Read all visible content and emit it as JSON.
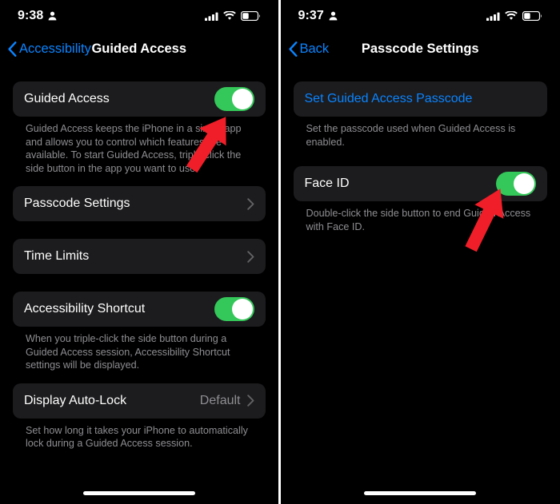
{
  "left": {
    "status": {
      "time": "9:38",
      "person_icon": "person-icon",
      "cellular_icon": "cellular-bars-icon",
      "wifi_icon": "wifi-icon",
      "battery_icon": "battery-icon"
    },
    "nav": {
      "back_label": "Accessibility",
      "title": "Guided Access"
    },
    "guided_access": {
      "label": "Guided Access",
      "toggle_state": "on",
      "footnote": "Guided Access keeps the iPhone in a single app and allows you to control which features are available. To start Guided Access, triple-click the side button in the app you want to use."
    },
    "passcode_settings": {
      "label": "Passcode Settings"
    },
    "time_limits": {
      "label": "Time Limits"
    },
    "accessibility_shortcut": {
      "label": "Accessibility Shortcut",
      "toggle_state": "on",
      "footnote": "When you triple-click the side button during a Guided Access session, Accessibility Shortcut settings will be displayed."
    },
    "display_auto_lock": {
      "label": "Display Auto-Lock",
      "value": "Default",
      "footnote": "Set how long it takes your iPhone to automatically lock during a Guided Access session."
    }
  },
  "right": {
    "status": {
      "time": "9:37",
      "person_icon": "person-icon",
      "cellular_icon": "cellular-bars-icon",
      "wifi_icon": "wifi-icon",
      "battery_icon": "battery-icon"
    },
    "nav": {
      "back_label": "Back",
      "title": "Passcode Settings"
    },
    "set_passcode": {
      "label": "Set Guided Access Passcode",
      "footnote": "Set the passcode used when Guided Access is enabled."
    },
    "face_id": {
      "label": "Face ID",
      "toggle_state": "on",
      "footnote": "Double-click the side button to end Guided Access with Face ID."
    }
  },
  "colors": {
    "background": "#000000",
    "card": "#1c1c1e",
    "accent_blue": "#0a84ff",
    "toggle_green": "#34c759",
    "secondary_text": "#8e8e93",
    "annotation_red": "#f01e28"
  },
  "annotations": {
    "arrow_left": "red-arrow-pointing-to-guided-access-toggle",
    "arrow_right": "red-arrow-pointing-to-face-id-toggle"
  }
}
